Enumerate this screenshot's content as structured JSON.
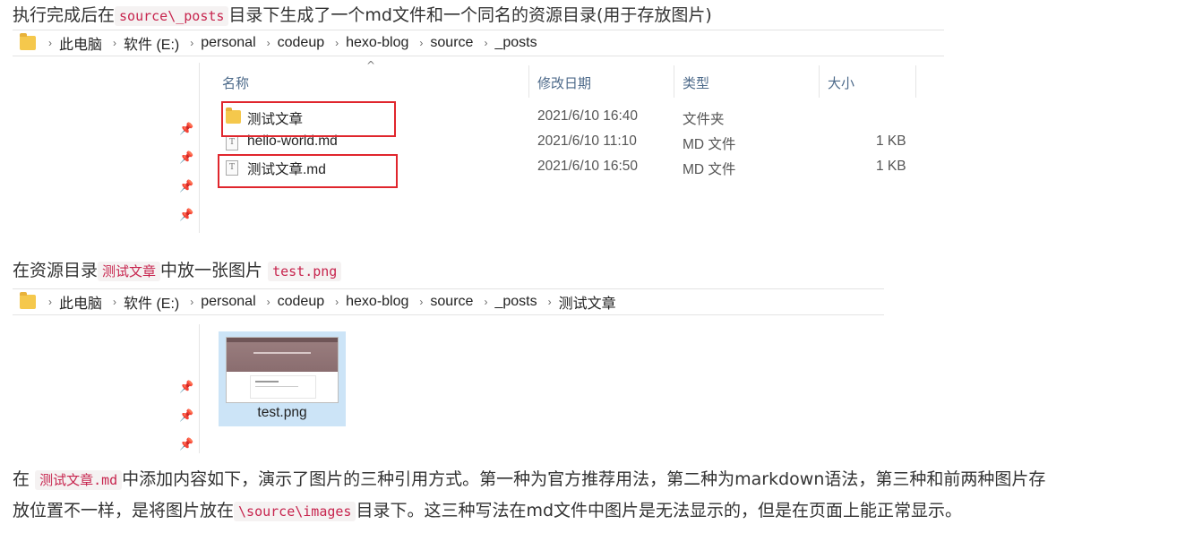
{
  "p1": {
    "before": "执行完成后在",
    "code": "source\\_posts",
    "after": "目录下生成了一个md文件和一个同名的资源目录(用于存放图片)"
  },
  "explorer1": {
    "path": [
      "此电脑",
      "软件 (E:)",
      "personal",
      "codeup",
      "hexo-blog",
      "source",
      "_posts"
    ],
    "columns": {
      "name": "名称",
      "date": "修改日期",
      "type": "类型",
      "size": "大小"
    },
    "rows": [
      {
        "icon": "folder-icon",
        "name": "测试文章",
        "date": "2021/6/10 16:40",
        "type": "文件夹",
        "size": "",
        "highlighted": true
      },
      {
        "icon": "text-file-icon",
        "name": "hello-world.md",
        "date": "2021/6/10 11:10",
        "type": "MD 文件",
        "size": "1 KB",
        "highlighted": false
      },
      {
        "icon": "text-file-icon",
        "name": "测试文章.md",
        "date": "2021/6/10 16:50",
        "type": "MD 文件",
        "size": "1 KB",
        "highlighted": true
      }
    ]
  },
  "p2": {
    "before": "在资源目录",
    "code1": "测试文章",
    "middle": "中放一张图片",
    "code2": "test.png"
  },
  "explorer2": {
    "path": [
      "此电脑",
      "软件 (E:)",
      "personal",
      "codeup",
      "hexo-blog",
      "source",
      "_posts",
      "测试文章"
    ],
    "file": {
      "name": "test.png"
    }
  },
  "p3": {
    "before": "在",
    "code": "测试文章.md",
    "line1_after": "中添加内容如下，演示了图片的三种引用方式。第一种为官方推荐用法，第二种为markdown语法，第三种和前两种图片存",
    "line2_before": "放位置不一样，是将图片放在",
    "code2": "\\source\\images",
    "line2_after": "目录下。这三种写法在md文件中图片是无法显示的，但是在页面上能正常显示。"
  },
  "colors": {
    "highlight_box": "#e0262d",
    "code_text": "#c7254e",
    "selected_tile": "#cce4f7",
    "column_header": "#4d6a8a"
  }
}
